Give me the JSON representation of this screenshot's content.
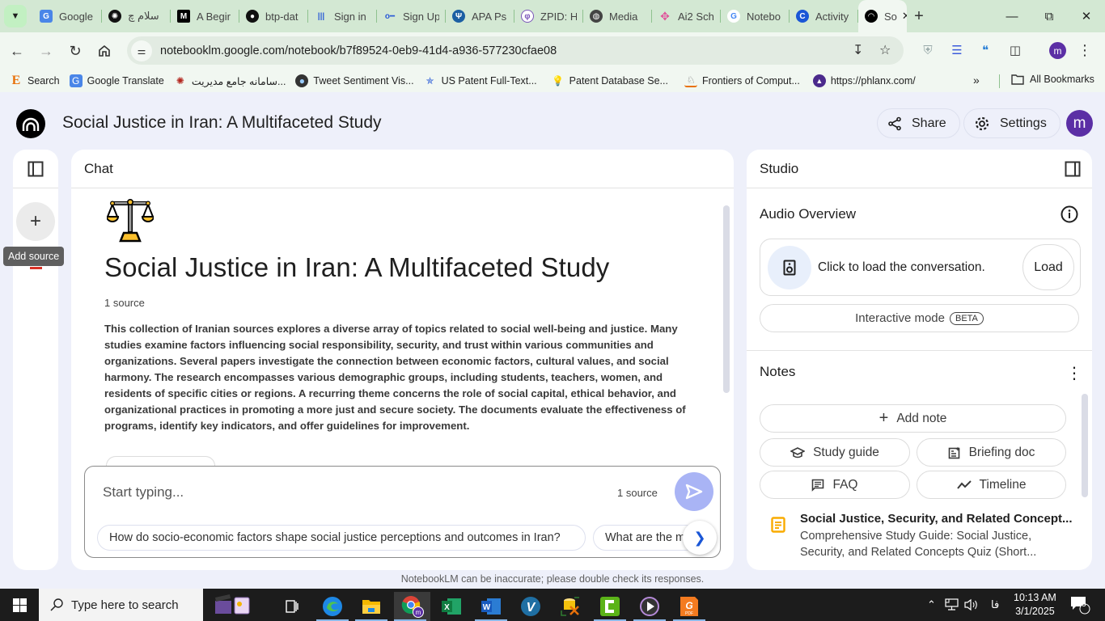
{
  "browser": {
    "tabs": [
      {
        "title": "Google",
        "favicon": "google-translate-icon",
        "color": "#4a86e8"
      },
      {
        "title": "سلام چ",
        "favicon": "openai-icon",
        "color": "#111111"
      },
      {
        "title": "A Begir",
        "favicon": "medium-icon",
        "color": "#000000"
      },
      {
        "title": "btp-dat",
        "favicon": "github-icon",
        "color": "#111111"
      },
      {
        "title": "Sign in",
        "favicon": "waveform-icon",
        "color": "#2a5bd7"
      },
      {
        "title": "Sign Up",
        "favicon": "key-icon",
        "color": "#2a5bd7"
      },
      {
        "title": "APA Ps",
        "favicon": "psi-icon",
        "color": "#1b5fa3"
      },
      {
        "title": "ZPID: H",
        "favicon": "zpid-icon",
        "color": "#7a55b8"
      },
      {
        "title": "Media",
        "favicon": "globe-icon",
        "color": "#444444"
      },
      {
        "title": "Ai2 Sch",
        "favicon": "ai2-icon",
        "color": "#e0559b"
      },
      {
        "title": "Notebo",
        "favicon": "google-icon",
        "color": "#4285f4"
      },
      {
        "title": "Activity",
        "favicon": "c-icon",
        "color": "#1a56d6"
      },
      {
        "title": "So",
        "favicon": "notebooklm-icon",
        "color": "#000000",
        "active": true
      }
    ],
    "new_tab": "+",
    "url": "notebooklm.google.com/notebook/b7f89524-0eb9-41d4-a936-577230cfae08",
    "profile_initial": "m",
    "bookmarks": [
      {
        "label": "Search",
        "icon": "e-icon"
      },
      {
        "label": "Google Translate",
        "icon": "google-translate-icon"
      },
      {
        "label": "سامانه جامع مدیریت...",
        "icon": "org-icon"
      },
      {
        "label": "Tweet Sentiment Vis...",
        "icon": "bird-icon"
      },
      {
        "label": "US Patent Full-Text...",
        "icon": "star-icon"
      },
      {
        "label": "Patent Database Se...",
        "icon": "bulb-icon"
      },
      {
        "label": "Frontiers of Comput...",
        "icon": "frontiers-icon"
      },
      {
        "label": "https://phlanx.com/",
        "icon": "phlanx-icon"
      }
    ],
    "bookmarks_more": "»",
    "all_bookmarks": "All Bookmarks"
  },
  "app": {
    "notebook_title": "Social Justice in Iran: A Multifaceted Study",
    "share_label": "Share",
    "settings_label": "Settings",
    "avatar_initial": "m",
    "sources": {
      "add_tooltip": "Add source"
    },
    "chat": {
      "header": "Chat",
      "emoji": "⚖️",
      "title": "Social Justice in Iran: A Multifaceted Study",
      "source_count": "1 source",
      "summary": "This collection of Iranian sources explores a diverse array of topics related to social well-being and justice. Many studies examine factors influencing social responsibility, security, and trust within various communities and organizations. Several papers investigate the connection between economic factors, cultural values, and social harmony. The research encompasses various demographic groups, including students, teachers, women, and residents of specific cities or regions. A recurring theme concerns the role of social capital, ethical behavior, and organizational practices in promoting a more just and secure society. The documents evaluate the effectiveness of programs, identify key indicators, and offer guidelines for improvement.",
      "input_placeholder": "Start typing...",
      "input_value": "",
      "input_source_count": "1 source",
      "suggestions": [
        "How do socio-economic factors shape social justice perceptions and outcomes in Iran?",
        "What are the m"
      ],
      "disclaimer": "NotebookLM can be inaccurate; please double check its responses."
    },
    "studio": {
      "header": "Studio",
      "audio_overview": {
        "title": "Audio Overview",
        "card_text": "Click to load the conversation.",
        "load_label": "Load",
        "interactive_label": "Interactive mode",
        "beta_badge": "BETA"
      },
      "notes": {
        "title": "Notes",
        "add_note": "Add note",
        "buttons": [
          {
            "label": "Study guide",
            "icon": "graduation-cap-icon"
          },
          {
            "label": "Briefing doc",
            "icon": "briefing-doc-icon"
          },
          {
            "label": "FAQ",
            "icon": "faq-icon"
          },
          {
            "label": "Timeline",
            "icon": "timeline-icon"
          }
        ],
        "items": [
          {
            "title": "Social Justice, Security, and Related Concept...",
            "subtitle": "Comprehensive Study Guide: Social Justice, Security, and Related Concepts Quiz (Short...",
            "icon_color": "#f9ab00"
          }
        ]
      }
    }
  },
  "taskbar": {
    "search_placeholder": "Type here to search",
    "time": "10:13 AM",
    "date": "3/1/2025",
    "language": "فا",
    "notification_count": "3"
  }
}
